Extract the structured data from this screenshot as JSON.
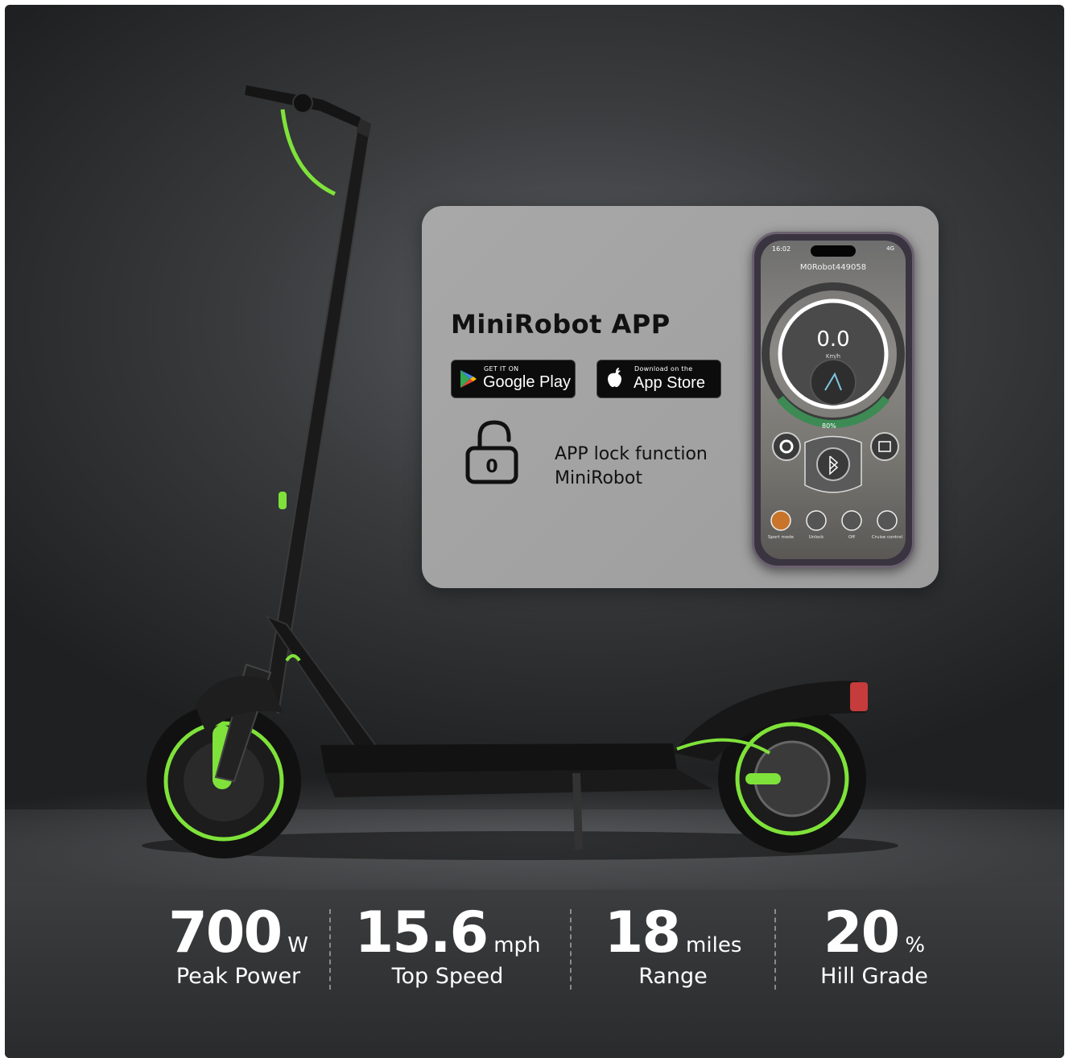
{
  "app_card": {
    "title": "MiniRobot APP",
    "google_play": {
      "small": "GET IT ON",
      "big": "Google Play"
    },
    "app_store": {
      "small": "Download on the",
      "big": "App Store"
    },
    "lock_text_line1": "APP lock function",
    "lock_text_line2": "MiniRobot",
    "lock_icon_glyph": "0"
  },
  "phone": {
    "status_time": "16:02",
    "status_right": "4G",
    "device_name": "M0Robot449058",
    "speed_value": "0.0",
    "speed_unit": "Km/h",
    "battery": "80%",
    "bottom_buttons": [
      {
        "label": "Sport mode"
      },
      {
        "label": "Unlock"
      },
      {
        "label": "Off"
      },
      {
        "label": "Cruise control"
      }
    ]
  },
  "stats": [
    {
      "value": "700",
      "unit": "W",
      "label": "Peak Power"
    },
    {
      "value": "15.6",
      "unit": "mph",
      "label": "Top Speed"
    },
    {
      "value": "18",
      "unit": "miles",
      "label": "Range"
    },
    {
      "value": "20",
      "unit": "%",
      "label": "Hill Grade"
    }
  ],
  "colors": {
    "accent_green": "#7fe23a",
    "card_bg": "#a4a4a4",
    "background": "#2e3032"
  }
}
